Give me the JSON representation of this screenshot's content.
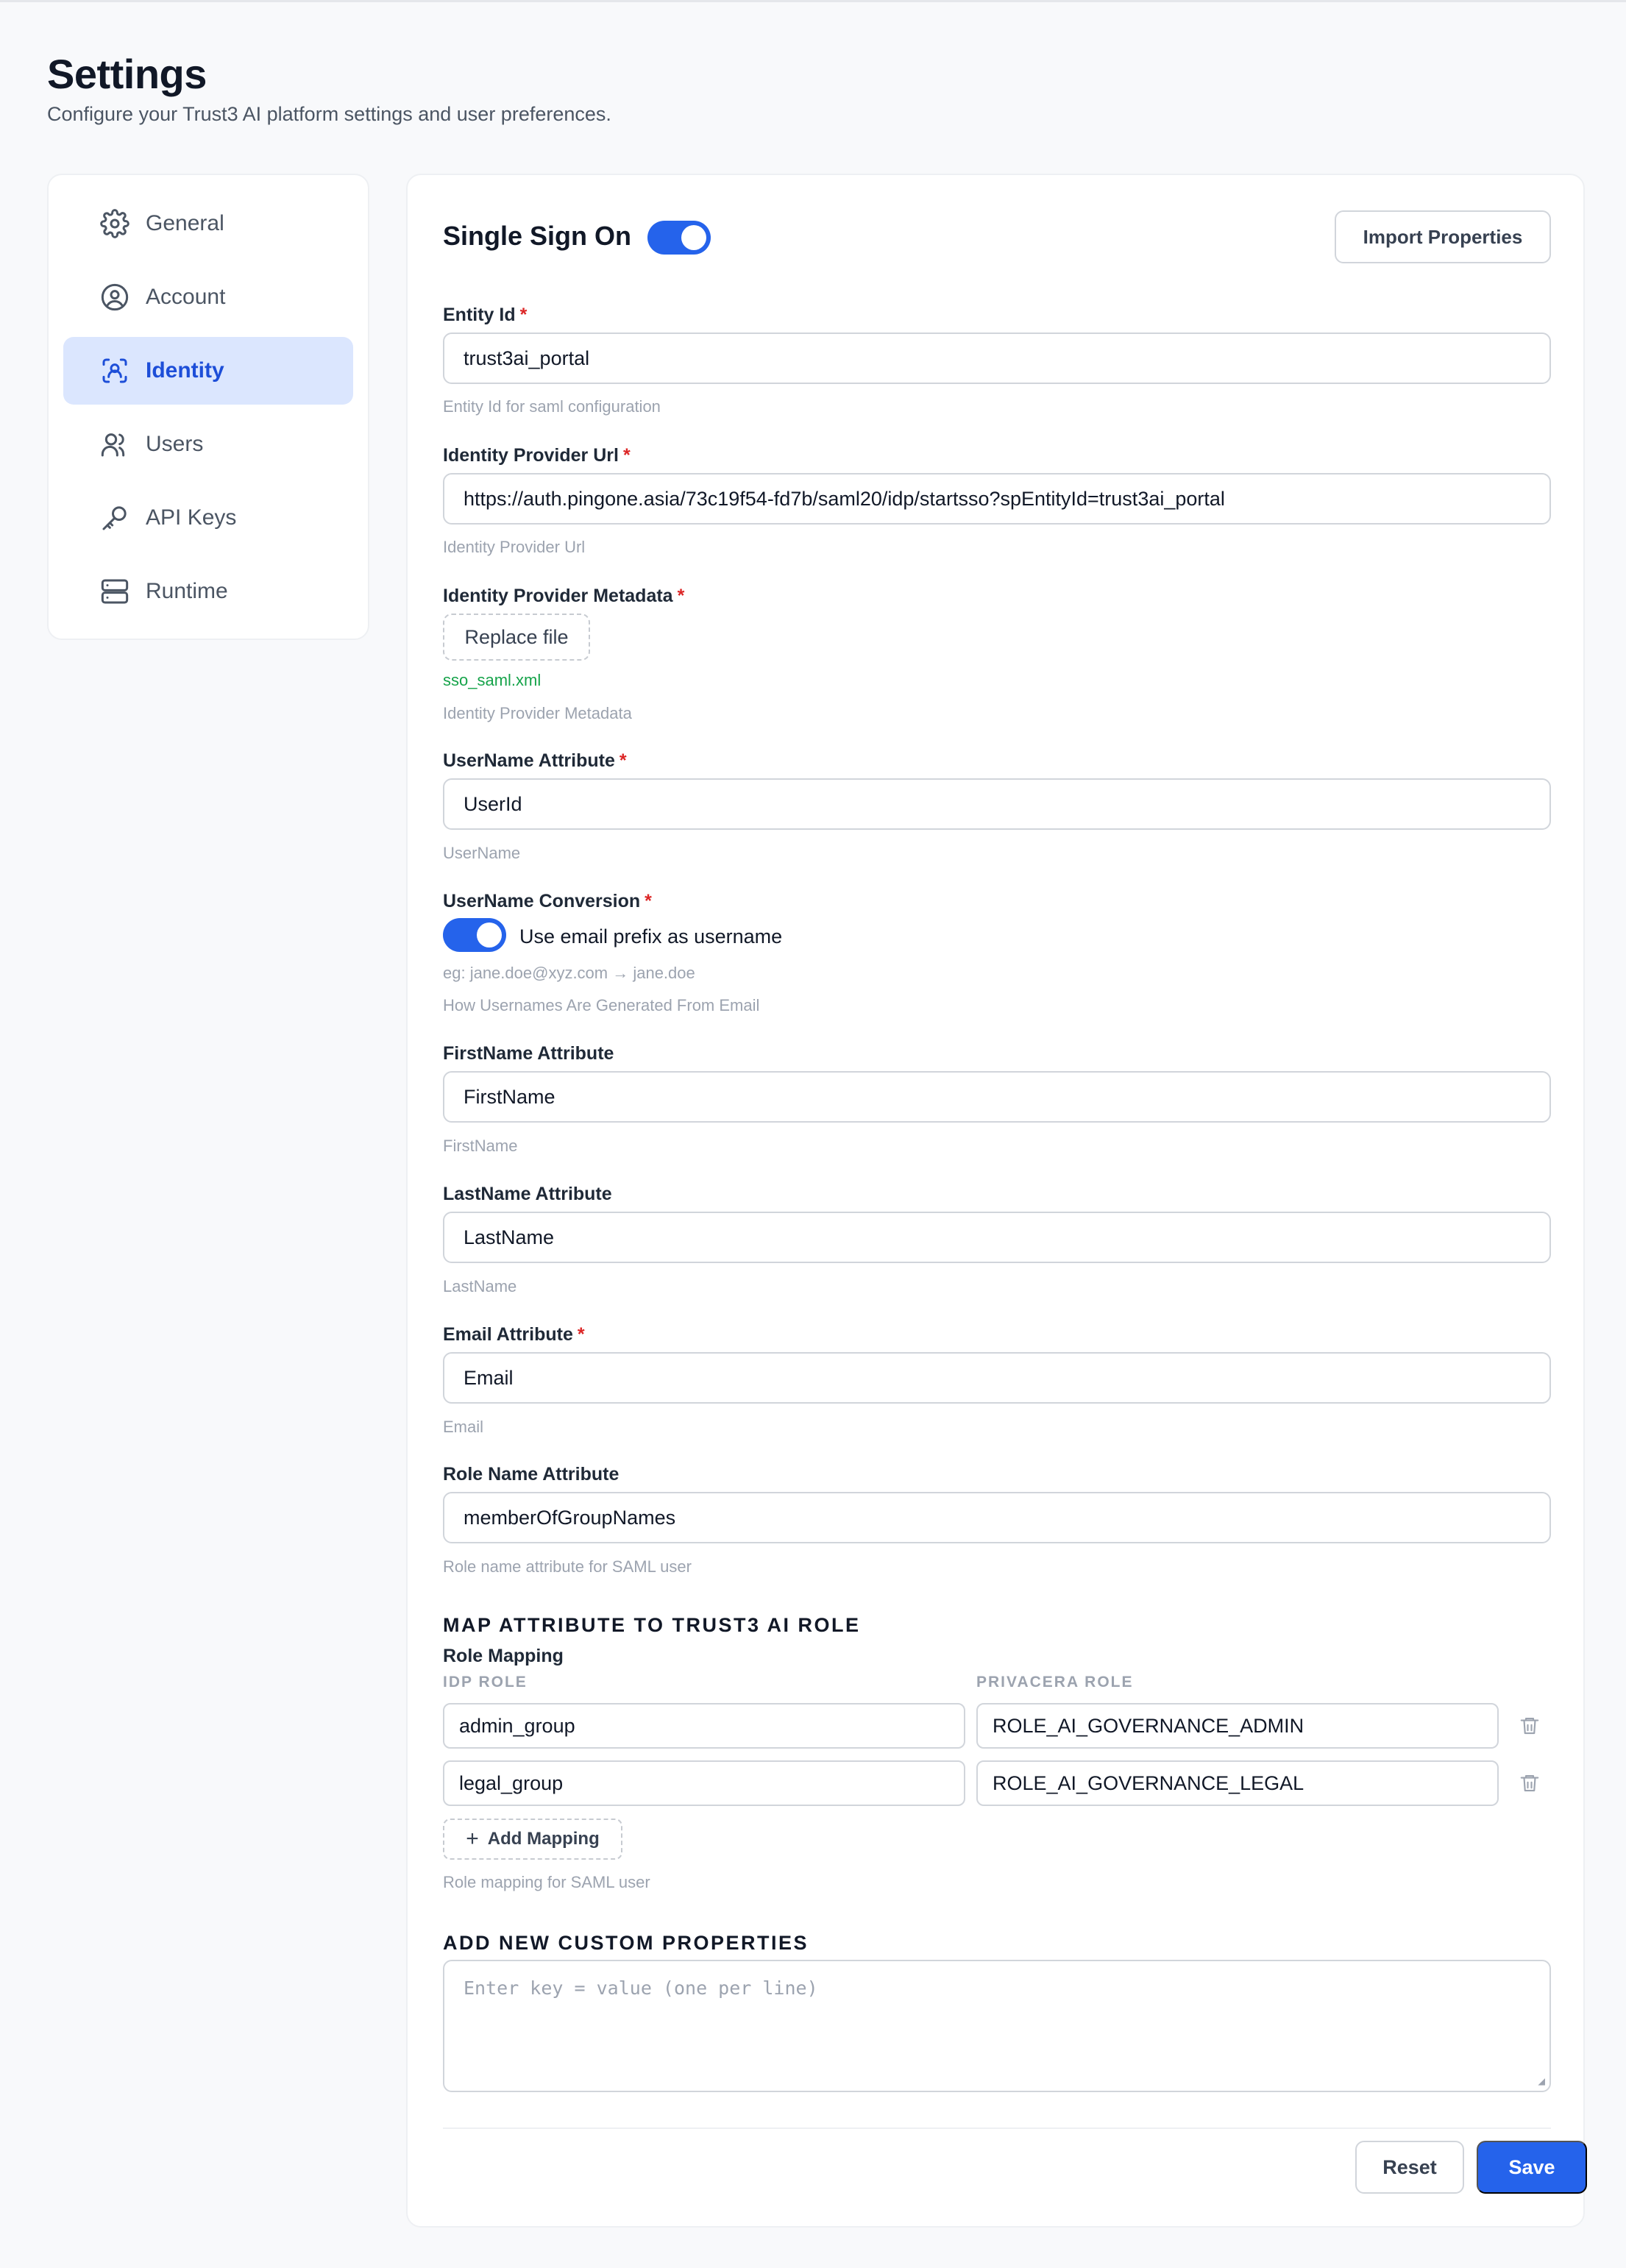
{
  "page": {
    "title": "Settings",
    "subtitle": "Configure your Trust3 AI platform settings and user preferences."
  },
  "sidebar": {
    "items": [
      {
        "label": "General",
        "icon": "gear-icon",
        "active": false
      },
      {
        "label": "Account",
        "icon": "user-circle-icon",
        "active": false
      },
      {
        "label": "Identity",
        "icon": "identity-scan-icon",
        "active": true
      },
      {
        "label": "Users",
        "icon": "users-icon",
        "active": false
      },
      {
        "label": "API Keys",
        "icon": "key-icon",
        "active": false
      },
      {
        "label": "Runtime",
        "icon": "server-icon",
        "active": false
      }
    ]
  },
  "sso": {
    "title": "Single Sign On",
    "enabled": true,
    "import_label": "Import Properties"
  },
  "fields": {
    "entity_id": {
      "label": "Entity Id",
      "required": "*",
      "value": "trust3ai_portal",
      "help": "Entity Id for saml configuration"
    },
    "idp_url": {
      "label": "Identity Provider Url",
      "required": "*",
      "value": "https://auth.pingone.asia/73c19f54-fd7b/saml20/idp/startsso?spEntityId=trust3ai_portal",
      "help": "Identity Provider Url"
    },
    "idp_metadata": {
      "label": "Identity Provider Metadata",
      "required": "*",
      "button": "Replace file",
      "file": "sso_saml.xml",
      "help": "Identity Provider Metadata"
    },
    "username_attr": {
      "label": "UserName Attribute",
      "required": "*",
      "value": "UserId",
      "help": "UserName"
    },
    "username_conv": {
      "label": "UserName Conversion",
      "required": "*",
      "enabled": true,
      "toggle_text": "Use email prefix as username",
      "example": "eg: jane.doe@xyz.com → jane.doe",
      "help": "How Usernames Are Generated From Email"
    },
    "firstname_attr": {
      "label": "FirstName Attribute",
      "value": "FirstName",
      "help": "FirstName"
    },
    "lastname_attr": {
      "label": "LastName Attribute",
      "value": "LastName",
      "help": "LastName"
    },
    "email_attr": {
      "label": "Email Attribute",
      "required": "*",
      "value": "Email",
      "help": "Email"
    },
    "role_attr": {
      "label": "Role Name Attribute",
      "value": "memberOfGroupNames",
      "help": "Role name attribute for SAML user"
    }
  },
  "role_mapping": {
    "section_title": "MAP ATTRIBUTE TO TRUST3 AI ROLE",
    "label": "Role Mapping",
    "col_idp": "IDP ROLE",
    "col_privacera": "PRIVACERA ROLE",
    "rows": [
      {
        "idp": "admin_group",
        "role": "ROLE_AI_GOVERNANCE_ADMIN"
      },
      {
        "idp": "legal_group",
        "role": "ROLE_AI_GOVERNANCE_LEGAL"
      }
    ],
    "add_label": "Add Mapping",
    "help": "Role mapping for SAML user"
  },
  "custom": {
    "section_title": "ADD NEW CUSTOM PROPERTIES",
    "placeholder": "Enter key = value (one per line)"
  },
  "actions": {
    "reset": "Reset",
    "save": "Save"
  },
  "colors": {
    "accent": "#2563eb",
    "active_bg": "#dbe6fe",
    "required": "#dc2626",
    "file_ok": "#16a34a"
  }
}
